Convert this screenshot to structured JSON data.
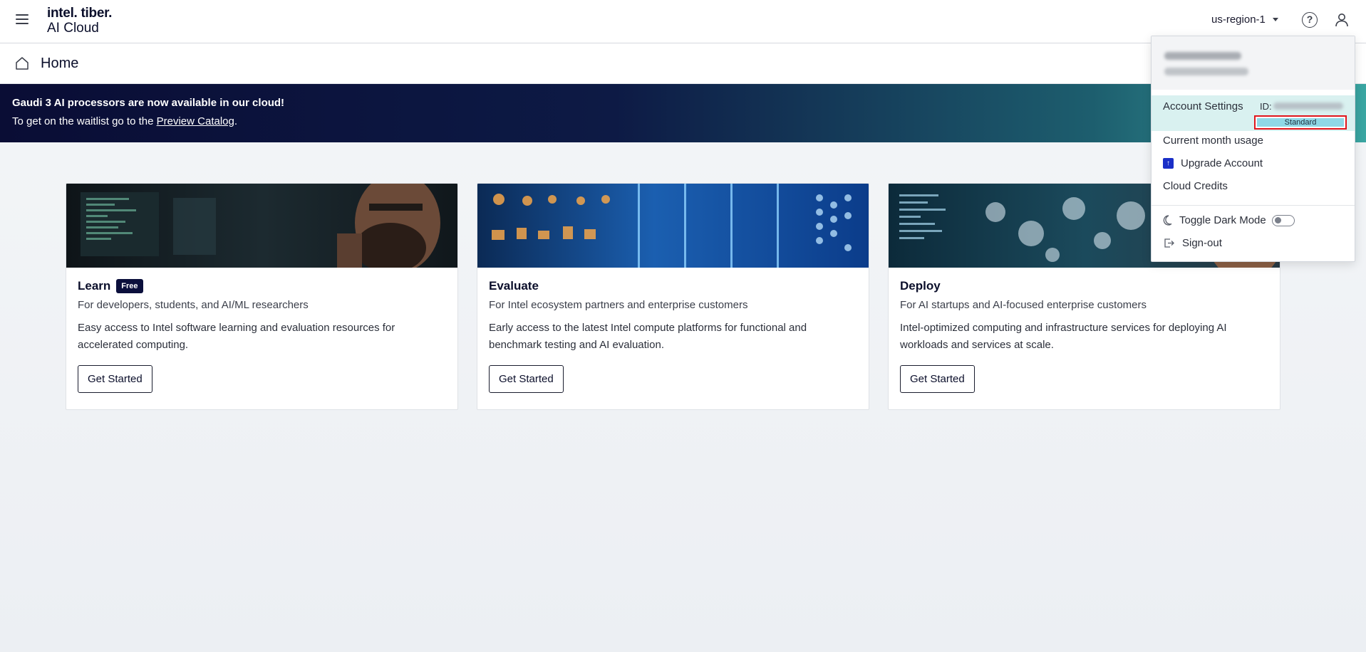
{
  "header": {
    "brand_top": "intel. tiber.",
    "brand_bottom": "AI Cloud",
    "region": "us-region-1",
    "help_glyph": "?"
  },
  "titlebar": {
    "title": "Home"
  },
  "banner": {
    "title": "Gaudi 3 AI processors are now available in our cloud!",
    "text_prefix": "To get on the waitlist go to the ",
    "link_text": "Preview Catalog",
    "text_suffix": "."
  },
  "cards": [
    {
      "title": "Learn",
      "badge": "Free",
      "subtitle": "For developers, students, and AI/ML researchers",
      "description": "Easy access to Intel software learning and evaluation resources for accelerated computing.",
      "button": "Get Started"
    },
    {
      "title": "Evaluate",
      "subtitle": "For Intel ecosystem partners and enterprise customers",
      "description": "Early access to the latest Intel compute platforms for functional and benchmark testing and AI evaluation.",
      "button": "Get Started"
    },
    {
      "title": "Deploy",
      "subtitle": "For AI startups and AI-focused enterprise customers",
      "description": "Intel-optimized computing and infrastructure services for deploying AI workloads and services at scale.",
      "button": "Get Started"
    }
  ],
  "dropdown": {
    "account_settings": "Account Settings",
    "id_label": "ID:",
    "account_type": "Standard",
    "current_month_usage": "Current month usage",
    "upgrade_account": "Upgrade Account",
    "cloud_credits": "Cloud Credits",
    "toggle_dark_mode": "Toggle Dark Mode",
    "dark_mode_enabled": false,
    "sign_out": "Sign-out"
  },
  "colors": {
    "banner_start": "#0a0d35",
    "banner_end": "#3aa6a2",
    "account_highlight": "#d9f1f0",
    "standard_badge": "#8fd8e6",
    "highlight_outline": "#e0161c",
    "upgrade_icon": "#1a2fc7"
  }
}
